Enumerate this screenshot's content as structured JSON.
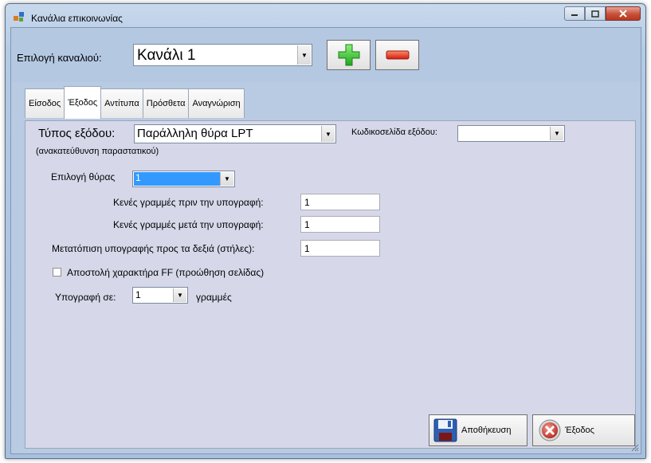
{
  "window": {
    "title": "Κανάλια επικοινωνίας",
    "controls": [
      "minimize",
      "maximize",
      "close"
    ]
  },
  "header": {
    "channel_label": "Επιλογή καναλιού:",
    "channel_value": "Κανάλι 1",
    "add_icon": "plus-icon",
    "remove_icon": "minus-icon"
  },
  "tabs": [
    {
      "label": "Είσοδος",
      "active": false
    },
    {
      "label": "Έξοδος",
      "active": true
    },
    {
      "label": "Αντίτυπα",
      "active": false
    },
    {
      "label": "Πρόσθετα",
      "active": false
    },
    {
      "label": "Αναγνώριση",
      "active": false
    }
  ],
  "output": {
    "type_label": "Τύπος εξόδου:",
    "type_value": "Παράλληλη θύρα LPT",
    "type_note": "(ανακατεύθυνση παραστατικού)",
    "codepage_label": "Κωδικοσελίδα εξόδου:",
    "codepage_value": "",
    "port_label": "Επιλογή θύρας",
    "port_value": "1",
    "blank_before_label": "Κενές γραμμές πριν την υπογραφή:",
    "blank_before_value": "1",
    "blank_after_label": "Κενές γραμμές μετά την υπογραφή:",
    "blank_after_value": "1",
    "shift_label": "Μετατόπιση υπογραφής προς τα δεξιά (στήλες):",
    "shift_value": "1",
    "ff_label": "Αποστολή χαρακτήρα FF (προώθηση σελίδας)",
    "ff_checked": false,
    "signature_label": "Υπογραφή σε:",
    "signature_value": "1",
    "signature_unit": "γραμμές"
  },
  "footer": {
    "save_label": "Αποθήκευση",
    "save_icon": "floppy-disk-icon",
    "exit_label": "Έξοδος",
    "exit_icon": "cancel-icon"
  },
  "colors": {
    "title_bg": "#b4cbe6",
    "tab_page_bg": "#d6d8ea",
    "selected_combo_bg": "#3399ff",
    "add_green": "#2ecc2e",
    "remove_red": "#e0321e"
  }
}
